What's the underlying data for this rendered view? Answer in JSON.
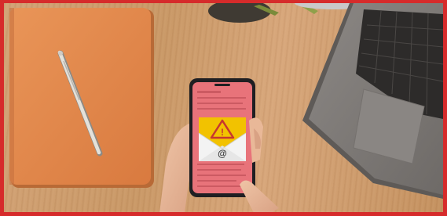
{
  "scene": {
    "kind": "stock-photo",
    "colors": {
      "frame_border": "#d62b2b",
      "desk_wood": "#cf9e70",
      "notebook": "#e3894e",
      "phone_screen": "#e8737a",
      "warning": "#f2c200",
      "laptop": "#7e7a77"
    },
    "elements": {
      "notebook_icon": "notebook",
      "pen_icon": "pen",
      "phone_icon": "smartphone",
      "warning_icon": "warning-triangle",
      "email_icon": "at-sign",
      "laptop_icon": "laptop"
    },
    "at_symbol": "@",
    "warning_symbol": "!"
  }
}
